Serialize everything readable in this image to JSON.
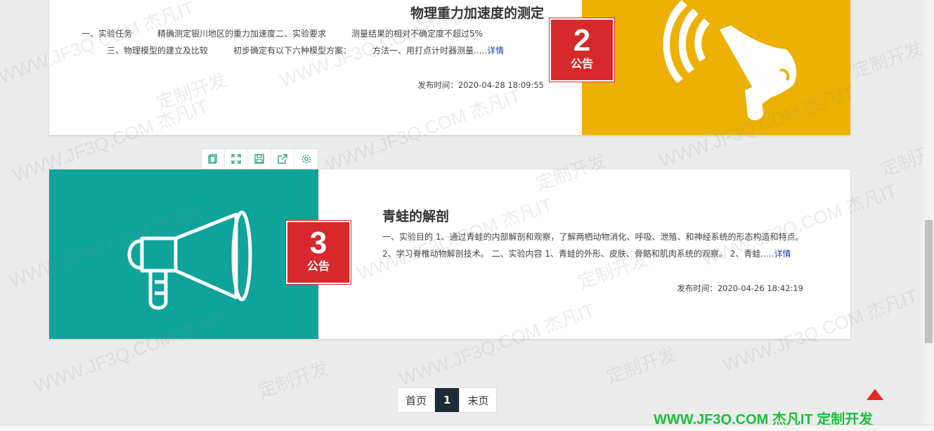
{
  "posts": [
    {
      "title": "物理重力加速度的测定",
      "excerpt_line1": "一、实验任务　　　精确测定银川地区的重力加速度二、实验要求　　　测量结果的相对不确定度不超过5%",
      "excerpt_line2": "　　　三、物理模型的建立及比较　　　初步确定有以下六种模型方案：　　　方法一、用打点计时器测量.....",
      "more_label": "详情",
      "date": "发布时间：2020-04-28 18:09:55",
      "badge_number": "2",
      "badge_label": "公告",
      "image_color": "#ecb103",
      "icon": "megaphone-icon"
    },
    {
      "title": "青蛙的解剖",
      "excerpt": "一、实验目的 1、通过青蛙的内部解剖和观察，了解两栖动物消化、呼吸、泄殖、和神经系统的形态构造和特点。 2、学习脊椎动物解剖技术。 二、实验内容 1、青蛙的外形、皮肤、骨骼和肌肉系统的观察。 2、青蛙.....",
      "more_label": "详情",
      "date": "发布时间：2020-04-26 18:42:19",
      "badge_number": "3",
      "badge_label": "公告",
      "image_color": "#0ea39b",
      "icon": "megaphone-icon"
    }
  ],
  "toolbar": {
    "icons": [
      "copy-icon",
      "fullscreen-icon",
      "save-icon",
      "share-icon",
      "settings-icon"
    ]
  },
  "pagination": {
    "first": "首页",
    "current": "1",
    "last": "末页"
  },
  "brand": {
    "text": "WWW.JF3Q.COM 杰凡IT 定制开发",
    "color": "#19c23a"
  },
  "watermark": {
    "domain": "WWW.JF3Q.COM 杰凡IT",
    "slogan": "定制开发"
  },
  "back_to_top_color": "#e32a25"
}
